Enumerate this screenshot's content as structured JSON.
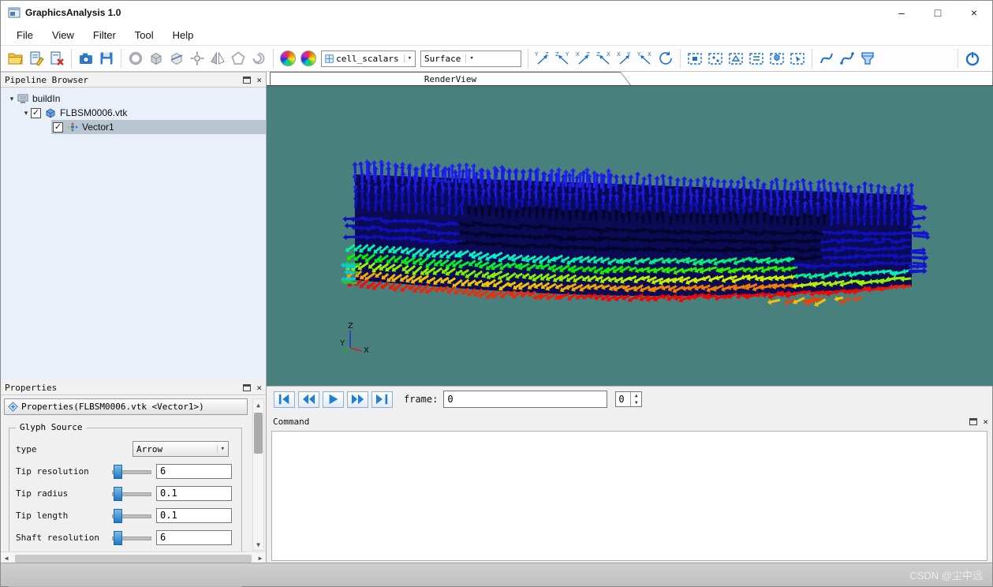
{
  "window": {
    "title": "GraphicsAnalysis 1.0",
    "controls": {
      "minimize": "–",
      "maximize": "□",
      "close": "×"
    }
  },
  "menu": {
    "items": [
      "File",
      "View",
      "Filter",
      "Tool",
      "Help"
    ]
  },
  "toolbar": {
    "scalar_field": "cell_scalars",
    "representation": "Surface"
  },
  "pipeline": {
    "title": "Pipeline Browser",
    "items": [
      {
        "label": "buildIn"
      },
      {
        "label": "FLBSM0006.vtk",
        "checked": true
      },
      {
        "label": "Vector1",
        "checked": true,
        "selected": true
      }
    ]
  },
  "renderview": {
    "tab": "RenderView",
    "axis": {
      "x": "X",
      "y": "Y",
      "z": "Z"
    }
  },
  "playback": {
    "frame_label": "frame:",
    "frame_value": "0",
    "spin_value": "0"
  },
  "command": {
    "title": "Command"
  },
  "properties": {
    "title": "Properties",
    "header_button": "Properties(FLBSM0006.vtk <Vector1>)",
    "group": "Glyph Source",
    "rows": [
      {
        "label": "type",
        "control": "dropdown",
        "value": "Arrow"
      },
      {
        "label": "Tip resolution",
        "control": "slider",
        "value": "6"
      },
      {
        "label": "Tip radius",
        "control": "slider",
        "value": "0.1"
      },
      {
        "label": "Tip length",
        "control": "slider",
        "value": "0.1"
      },
      {
        "label": "Shaft resolution",
        "control": "slider",
        "value": "6"
      }
    ]
  },
  "statusbar": {
    "watermark": "CSDN @尘中远"
  },
  "icons": {
    "dropdown_arrow": "▾",
    "check": "✓",
    "expander": "▾",
    "panel_close": "×",
    "scroll_up": "▲",
    "scroll_down": "▼",
    "scroll_left": "◀",
    "scroll_right": "▶"
  },
  "colors": {
    "render_background": "#47807d",
    "accent_blue": "#1f7fd0",
    "tree_selection": "#b9c5d1"
  }
}
